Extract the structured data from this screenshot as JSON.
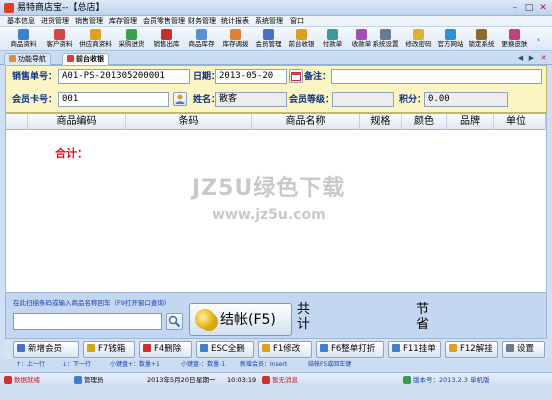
{
  "window": {
    "title": "易特商店宝--【总店】"
  },
  "menu": [
    "基本信息",
    "进货管理",
    "销售管理",
    "库存管理",
    "会员零售管理",
    "财务管理",
    "统计报表",
    "系统管理",
    "窗口"
  ],
  "toolbar": [
    {
      "label": "商品资料",
      "color": "#3a7fd0"
    },
    {
      "label": "客户资料",
      "color": "#d04848"
    },
    {
      "label": "供应商资料",
      "color": "#e0a020"
    },
    {
      "label": "采购进货",
      "color": "#3aa050"
    },
    {
      "label": "销售出库",
      "color": "#c83030"
    },
    {
      "label": "商品库存",
      "color": "#5a8fd8"
    },
    {
      "label": "库存调拨",
      "color": "#e08030"
    },
    {
      "label": "会员管理",
      "color": "#4a70c8"
    },
    {
      "label": "前台收银",
      "color": "#d8a020"
    },
    {
      "label": "付款单",
      "color": "#3a9a9a"
    },
    {
      "label": "收款单",
      "color": "#a050b0"
    },
    {
      "label": "系统设置",
      "color": "#6b7b8f"
    },
    {
      "label": "修改密码",
      "color": "#e0b030"
    },
    {
      "label": "官方网站",
      "color": "#2f8fd8"
    },
    {
      "label": "锁定系统",
      "color": "#8a6a30"
    },
    {
      "label": "更换皮肤",
      "color": "#c04080"
    }
  ],
  "tabs": [
    {
      "label": "功能导航",
      "color": "#e09030"
    },
    {
      "label": "前台收银",
      "color": "#d04040"
    }
  ],
  "form": {
    "sale_no_label": "销售单号：",
    "sale_no": "A01-PS-201305200001",
    "date_label": "日期：",
    "date": "2013-05-20",
    "remark_label": "备注：",
    "remark": "",
    "member_card_label": "会员卡号：",
    "member_card": "001",
    "name_label": "姓名：",
    "name": "散客",
    "member_level_label": "会员等级：",
    "member_level": "",
    "points_label": "积分：",
    "points": "0.00"
  },
  "grid": {
    "columns": [
      "商品编码",
      "条码",
      "商品名称",
      "规格",
      "颜色",
      "品牌",
      "单位"
    ],
    "total_label": "合计："
  },
  "watermark": {
    "title": "JZ5U绿色下载",
    "url": "www.jz5u.com"
  },
  "scan": {
    "label": "在此扫描条码或输入商品名称回车（F9打开窗口查询）",
    "value": ""
  },
  "checkout": {
    "label": "结帐(F5)",
    "total_label": "共计",
    "saving_label": "节省"
  },
  "fkeys": [
    {
      "label": "新增会员",
      "color": "#4a70c8"
    },
    {
      "label": "F7钱箱",
      "color": "#d8a020"
    },
    {
      "label": "F4删除",
      "color": "#d03030"
    },
    {
      "label": "ESC全删",
      "color": "#3a7fd0"
    },
    {
      "label": "F1修改",
      "color": "#e0a020"
    },
    {
      "label": "F6整单打折",
      "color": "#3a7fd0"
    },
    {
      "label": "F11挂单",
      "color": "#3a7fd0"
    },
    {
      "label": "F12解挂",
      "color": "#e0a020"
    },
    {
      "label": "设置",
      "color": "#6b7b8f"
    }
  ],
  "hints": [
    "↑：上一行",
    "↓：下一行",
    "小键盘+：数量+1",
    "小键盘-：数量-1",
    "新增会员：Insert",
    "结帐F5或回车键"
  ],
  "status": {
    "ready": "数据就绪",
    "user": "管理员",
    "date": "2013年5月20日",
    "weekday": "星期一",
    "time": "10:03:19",
    "message": "暂无消息",
    "version": "版本号：2013.2.3 单机版"
  }
}
